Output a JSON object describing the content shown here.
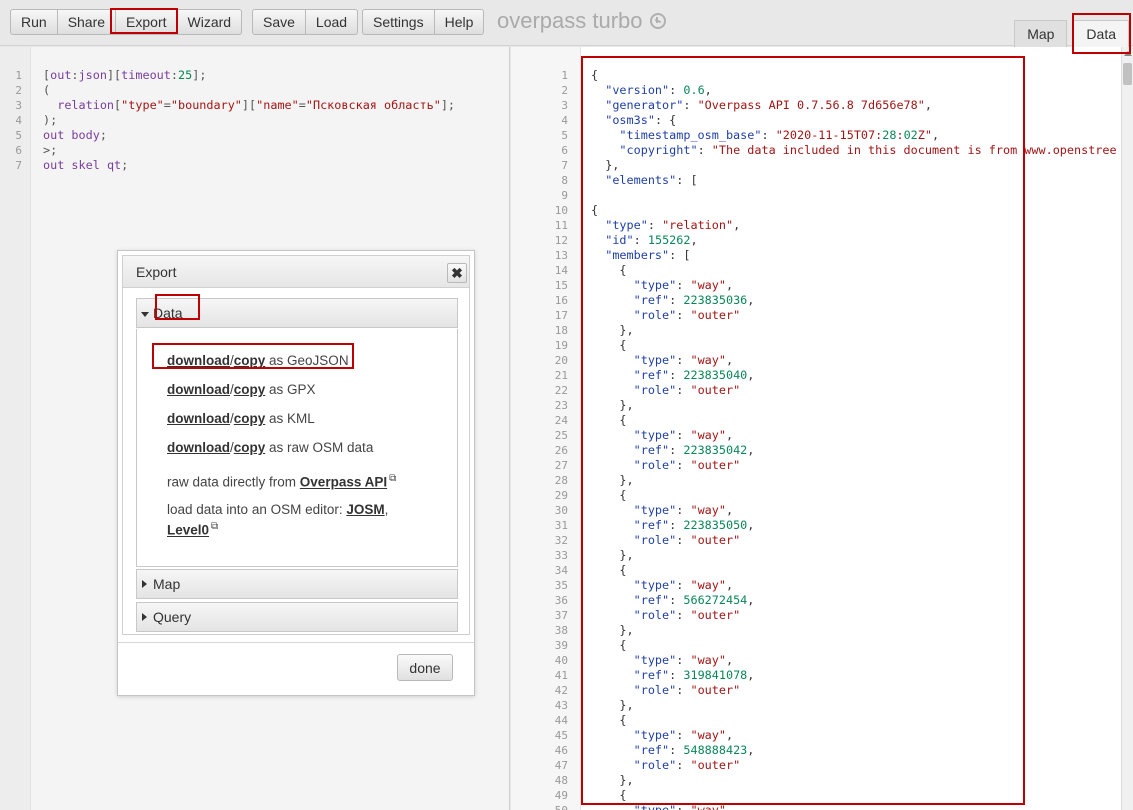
{
  "toolbar": {
    "group1": [
      "Run",
      "Share",
      "Export",
      "Wizard"
    ],
    "group2": [
      "Save",
      "Load"
    ],
    "group3": [
      "Settings",
      "Help"
    ],
    "brand": "overpass turbo"
  },
  "view_tabs": {
    "map": "Map",
    "data": "Data"
  },
  "editor": {
    "lines": [
      "[out:json][timeout:25];",
      "(",
      "  relation[\"type\"=\"boundary\"][\"name\"=\"Псковская область\"];",
      ");",
      "out body;",
      ">;",
      "out skel qt;"
    ]
  },
  "export_dialog": {
    "title": "Export",
    "sections": {
      "data": "Data",
      "map": "Map",
      "query": "Query"
    },
    "data_items": [
      {
        "download": "download",
        "sep": "/",
        "copy": "copy",
        "suffix": " as GeoJSON"
      },
      {
        "download": "download",
        "sep": "/",
        "copy": "copy",
        "suffix": " as GPX"
      },
      {
        "download": "download",
        "sep": "/",
        "copy": "copy",
        "suffix": " as KML"
      },
      {
        "download": "download",
        "sep": "/",
        "copy": "copy",
        "suffix": " as raw OSM data"
      }
    ],
    "raw_prefix": "raw data directly from ",
    "raw_link": "Overpass API",
    "editor_prefix": "load data into an OSM editor: ",
    "josm": "JOSM",
    "comma": ",",
    "level0": "Level0",
    "done": "done"
  },
  "data_view": {
    "lines": [
      "{",
      "  \"version\": 0.6,",
      "  \"generator\": \"Overpass API 0.7.56.8 7d656e78\",",
      "  \"osm3s\": {",
      "    \"timestamp_osm_base\": \"2020-11-15T07:28:02Z\",",
      "    \"copyright\": \"The data included in this document is from www.openstree",
      "  },",
      "  \"elements\": [",
      "",
      "{",
      "  \"type\": \"relation\",",
      "  \"id\": 155262,",
      "  \"members\": [",
      "    {",
      "      \"type\": \"way\",",
      "      \"ref\": 223835036,",
      "      \"role\": \"outer\"",
      "    },",
      "    {",
      "      \"type\": \"way\",",
      "      \"ref\": 223835040,",
      "      \"role\": \"outer\"",
      "    },",
      "    {",
      "      \"type\": \"way\",",
      "      \"ref\": 223835042,",
      "      \"role\": \"outer\"",
      "    },",
      "    {",
      "      \"type\": \"way\",",
      "      \"ref\": 223835050,",
      "      \"role\": \"outer\"",
      "    },",
      "    {",
      "      \"type\": \"way\",",
      "      \"ref\": 566272454,",
      "      \"role\": \"outer\"",
      "    },",
      "    {",
      "      \"type\": \"way\",",
      "      \"ref\": 319841078,",
      "      \"role\": \"outer\"",
      "    },",
      "    {",
      "      \"type\": \"way\",",
      "      \"ref\": 548888423,",
      "      \"role\": \"outer\"",
      "    },",
      "    {",
      "      \"type\": \"way\","
    ]
  },
  "colors": {
    "highlight": "#c00000",
    "json_key": "#1f3fa8",
    "json_string": "#a31515",
    "json_number": "#098658",
    "keyword": "#7a3e9d"
  }
}
